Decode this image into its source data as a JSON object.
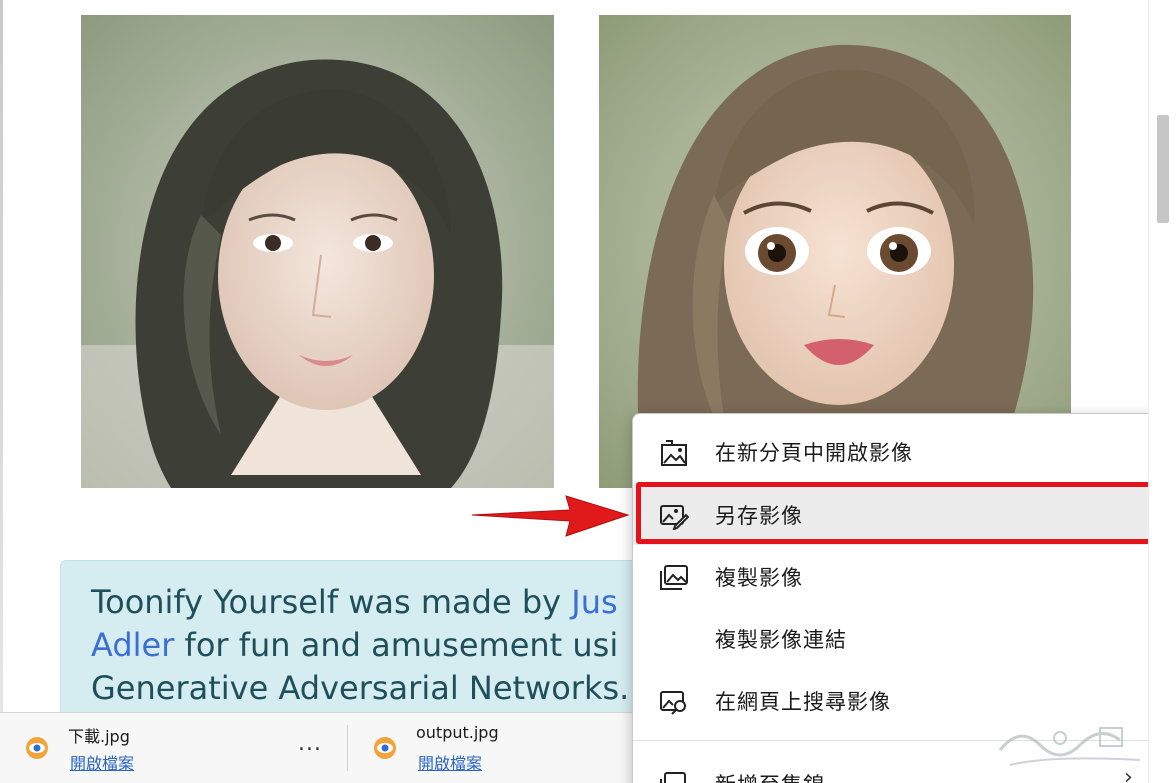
{
  "info_box": {
    "line1_prefix": "Toonify Yourself was made by ",
    "line1_link": "Jus",
    "line2_link": "Adler",
    "line2_suffix": " for fun and amusement usi",
    "line3": "Generative Adversarial Networks."
  },
  "downloads": [
    {
      "filename": "下載.jpg",
      "action": "開啟檔案",
      "more": "..."
    },
    {
      "filename": "output.jpg",
      "action": "開啟檔案"
    }
  ],
  "context_menu": {
    "items": [
      {
        "label": "在新分頁中開啟影像",
        "icon": "open-image-new-tab-icon"
      },
      {
        "label": "另存影像",
        "icon": "save-image-icon",
        "highlighted": true
      },
      {
        "label": "複製影像",
        "icon": "copy-image-icon"
      },
      {
        "label": "複製影像連結",
        "icon": ""
      },
      {
        "label": "在網頁上搜尋影像",
        "icon": "search-image-icon"
      },
      {
        "label": "新增至集錦",
        "icon": "add-to-collections-icon"
      }
    ],
    "highlight_color": "#e5121b"
  },
  "colors": {
    "info_bg": "#d5edf1",
    "info_text": "#1f4f5b",
    "link": "#3b6fd4",
    "arrow": "#e01a1a"
  }
}
